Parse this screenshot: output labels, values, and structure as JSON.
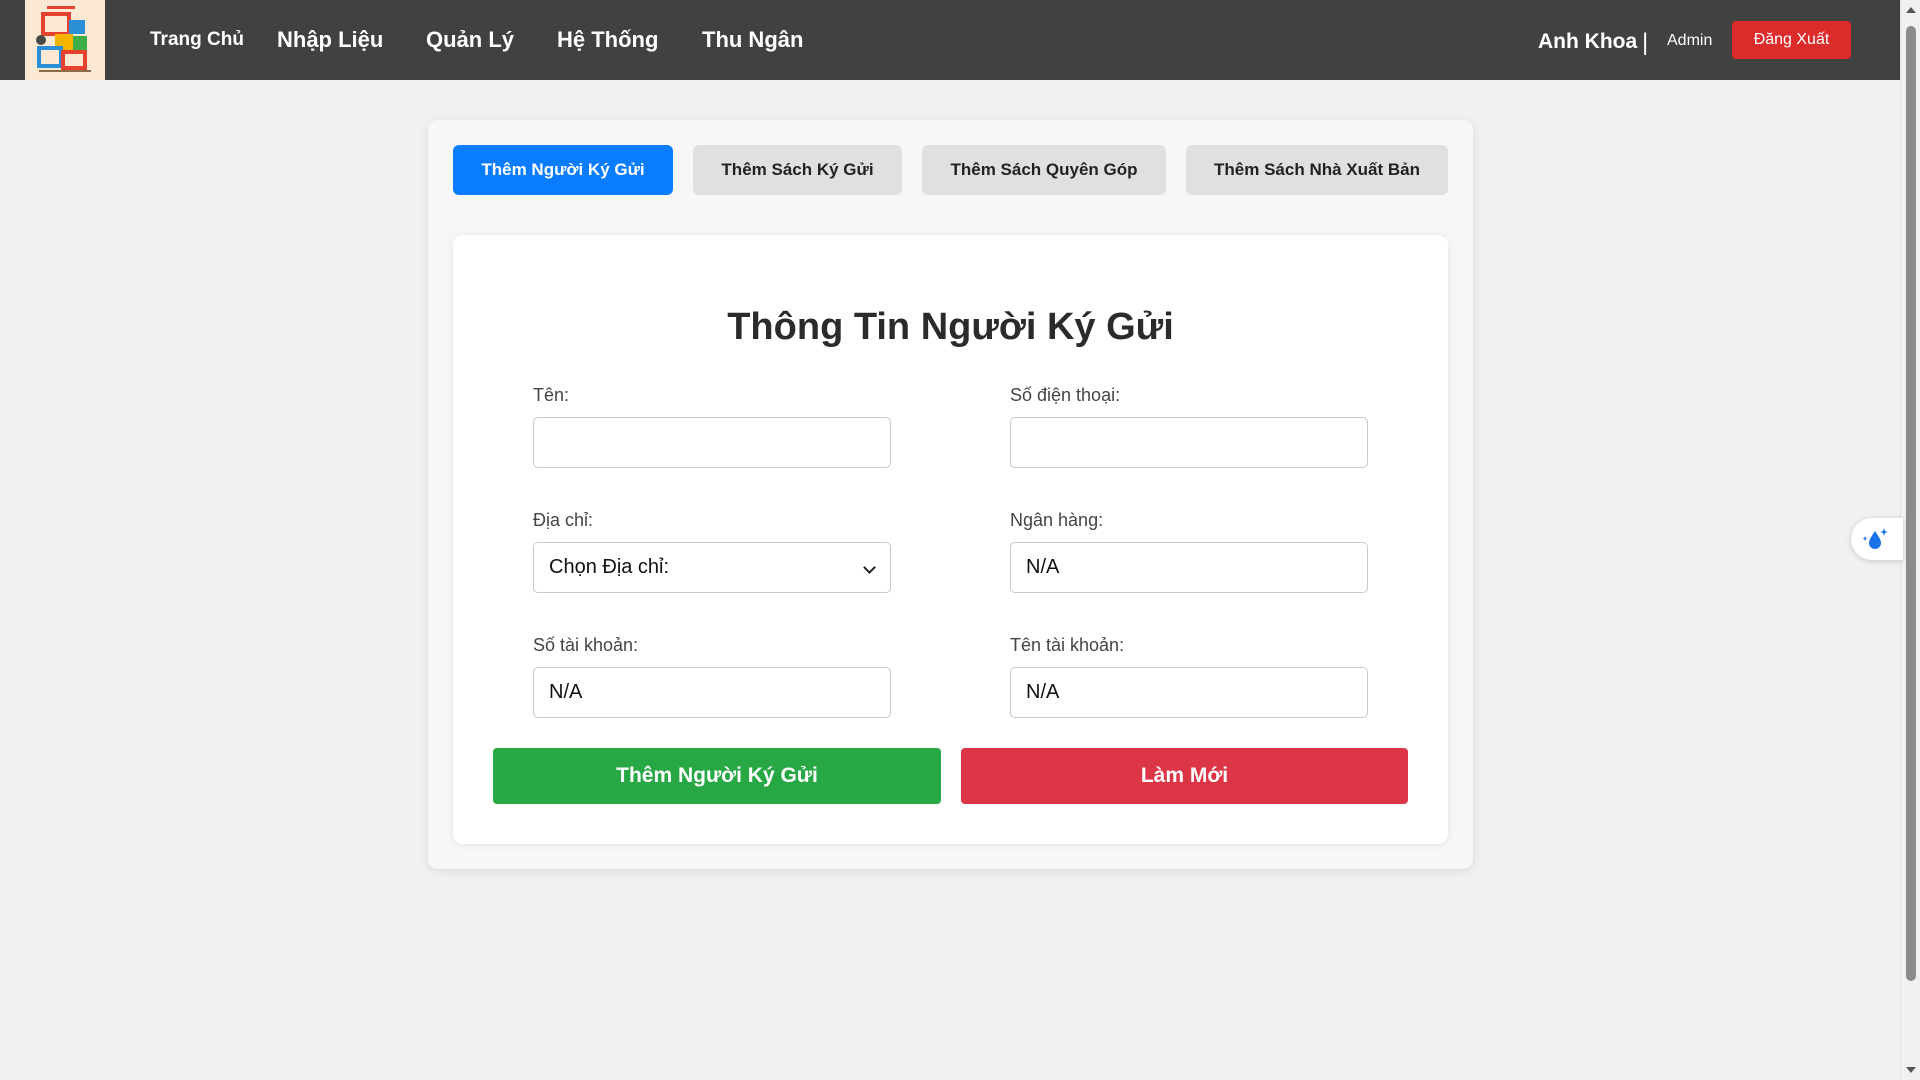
{
  "navbar": {
    "logo_alt": "Hội Sách",
    "links": {
      "home": "Trang Chủ",
      "data_entry": "Nhập Liệu",
      "manage": "Quản Lý",
      "system": "Hệ Thống",
      "cashier": "Thu Ngân"
    },
    "user": {
      "name": "Anh Khoa",
      "separator": "|",
      "role": "Admin",
      "logout_label": "Đăng Xuất"
    }
  },
  "tabs": [
    {
      "label": "Thêm Người Ký Gửi",
      "active": true
    },
    {
      "label": "Thêm Sách Ký Gửi",
      "active": false
    },
    {
      "label": "Thêm Sách Quyên Góp",
      "active": false
    },
    {
      "label": "Thêm Sách Nhà Xuất Bản",
      "active": false
    }
  ],
  "form": {
    "title": "Thông Tin Người Ký Gửi",
    "fields": {
      "name": {
        "label": "Tên:",
        "value": ""
      },
      "phone": {
        "label": "Số điện thoại:",
        "value": ""
      },
      "address": {
        "label": "Địa chỉ:",
        "selected": "Chọn Địa chỉ:"
      },
      "bank": {
        "label": "Ngân hàng:",
        "value": "N/A"
      },
      "account_number": {
        "label": "Số tài khoản:",
        "value": "N/A"
      },
      "account_name": {
        "label": "Tên tài khoản:",
        "value": "N/A"
      }
    },
    "buttons": {
      "submit": "Thêm Người Ký Gửi",
      "reset": "Làm Mới"
    }
  },
  "colors": {
    "navbar_bg": "#414141",
    "active_tab": "#0a7cff",
    "submit_button": "#28a745",
    "reset_button": "#dc3545",
    "logout_button": "#dc2b2b"
  },
  "icons": {
    "floating_button": "water-drop-sparkle-icon",
    "select_arrow": "chevron-down-icon"
  }
}
